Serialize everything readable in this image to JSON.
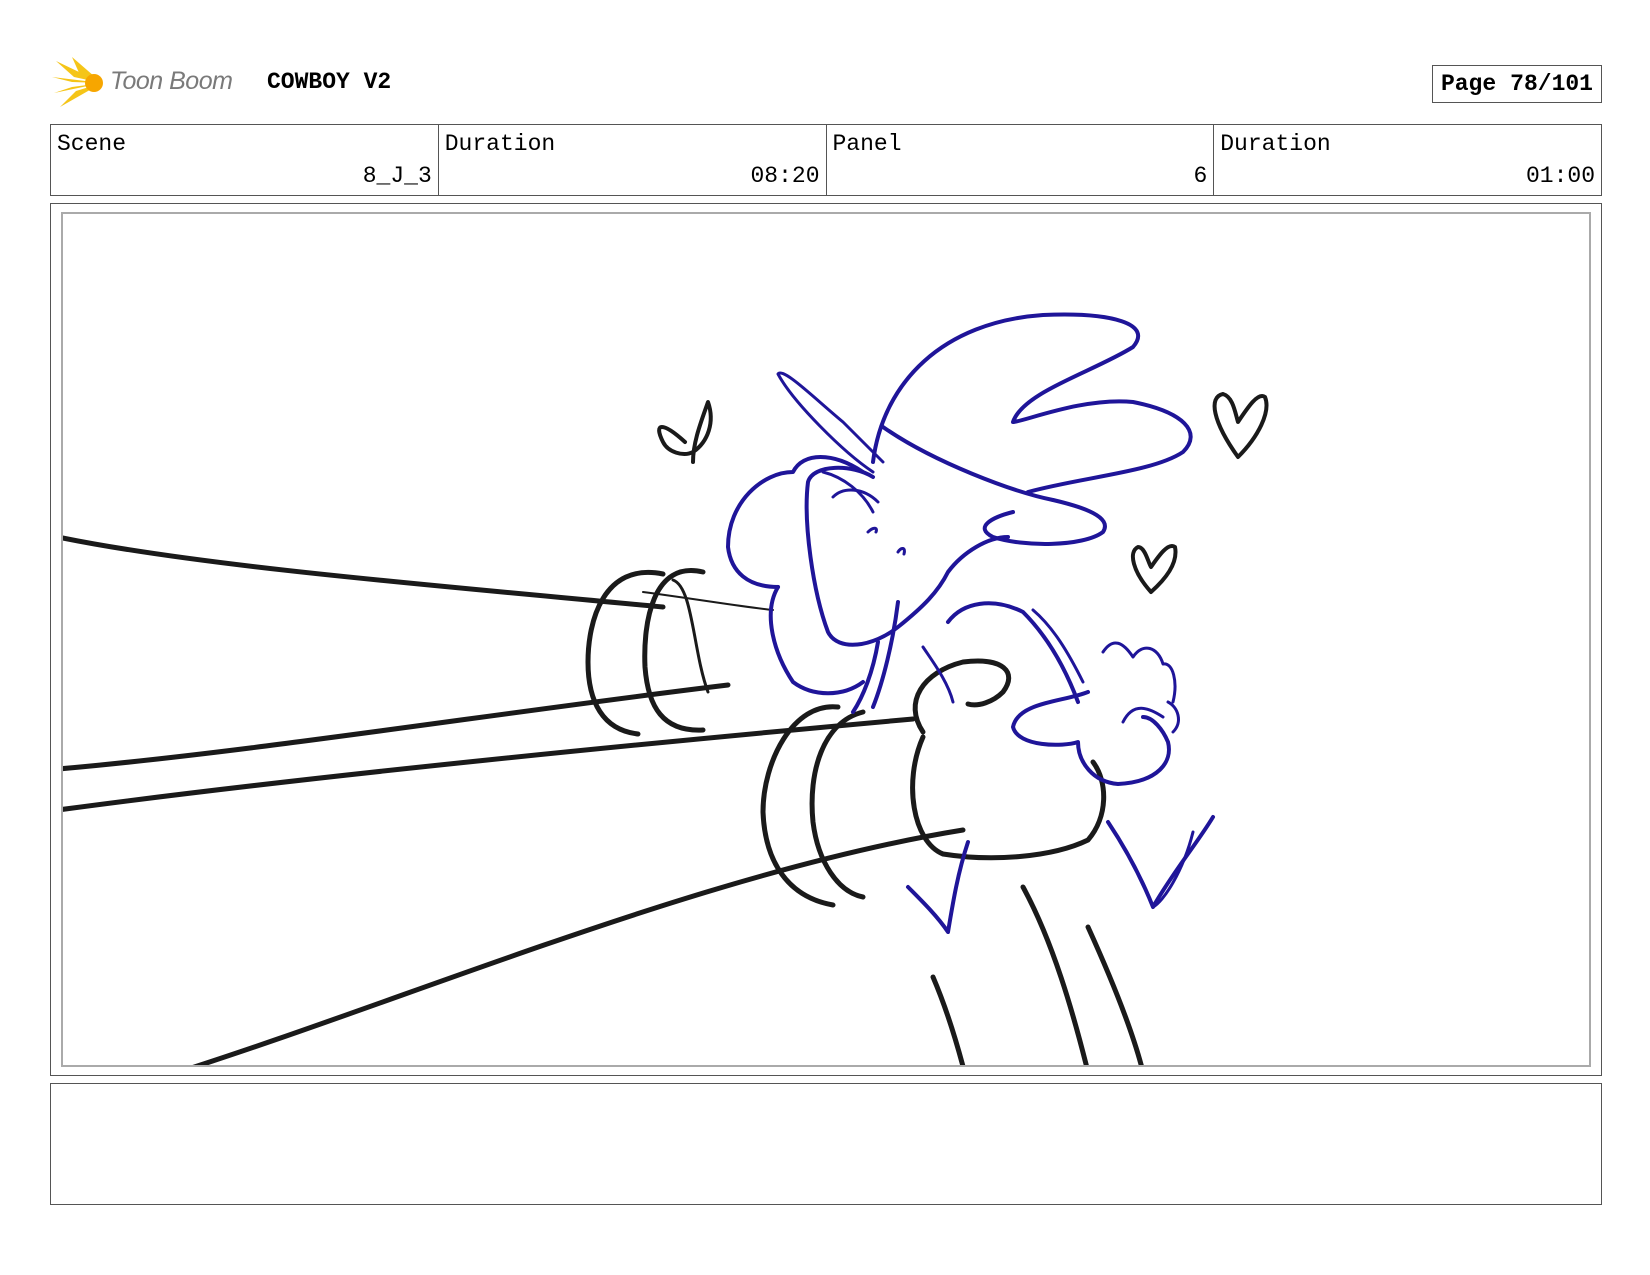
{
  "header": {
    "logo_text": "Toon Boom",
    "project_title": "COWBOY V2",
    "page_label": "Page",
    "page_value": "78/101"
  },
  "info": {
    "scene_label": "Scene",
    "scene_value": "8_J_3",
    "duration_label": "Duration",
    "duration_value": "08:20",
    "panel_label": "Panel",
    "panel_value": "6",
    "panel_duration_label": "Duration",
    "panel_duration_value": "01:00"
  },
  "colors": {
    "sketch_ink": "#1a1a1a",
    "character_ink": "#1f1599",
    "logo_accent": "#f5c518"
  }
}
